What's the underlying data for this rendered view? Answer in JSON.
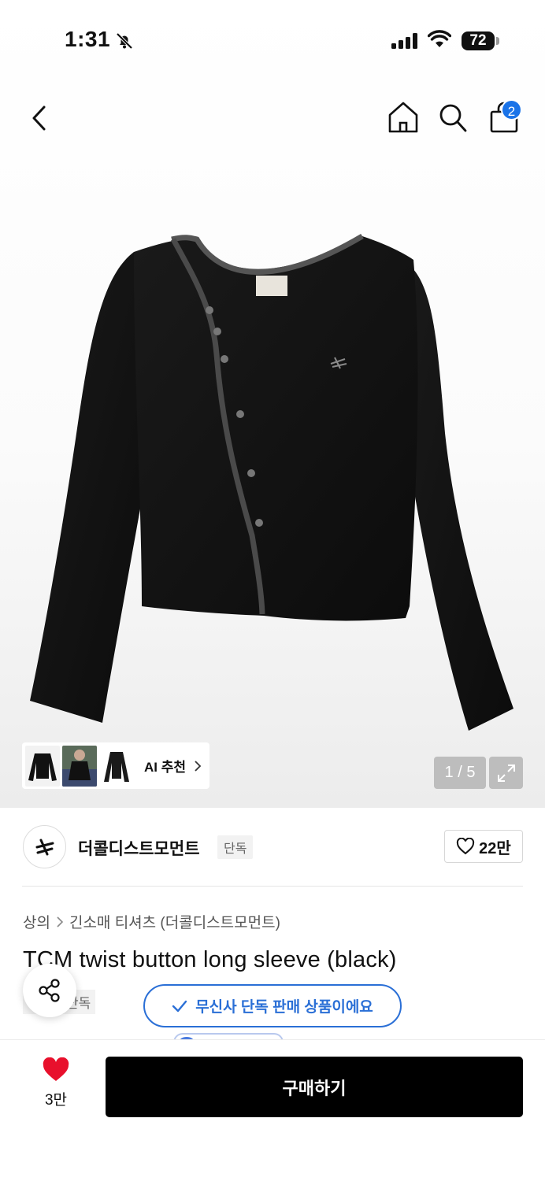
{
  "status_bar": {
    "time": "1:31",
    "battery": "72"
  },
  "header": {
    "cart_count": "2"
  },
  "gallery": {
    "ai_label": "AI 추천",
    "page_indicator": "1 / 5"
  },
  "brand": {
    "name": "더콜디스트모먼트",
    "tag": "단독",
    "like_count": "22만"
  },
  "product": {
    "breadcrumb": [
      "상의",
      "긴소매 티셔츠 (더콜디스트모먼트)"
    ],
    "title": "TCM twist button long sleeve (black)",
    "exclusive_tag": "단독"
  },
  "toast": {
    "message": "무신사 단독 판매 상품이에요"
  },
  "bottom_bar": {
    "wish_count": "3만",
    "buy_label": "구매하기"
  },
  "colors": {
    "accent_blue": "#2a6fd6",
    "heart_red": "#e8102c",
    "buy_bg": "#000000"
  },
  "icons": [
    "back-icon",
    "home-icon",
    "search-icon",
    "cart-icon",
    "expand-icon",
    "share-icon",
    "heart-icon",
    "check-icon"
  ]
}
